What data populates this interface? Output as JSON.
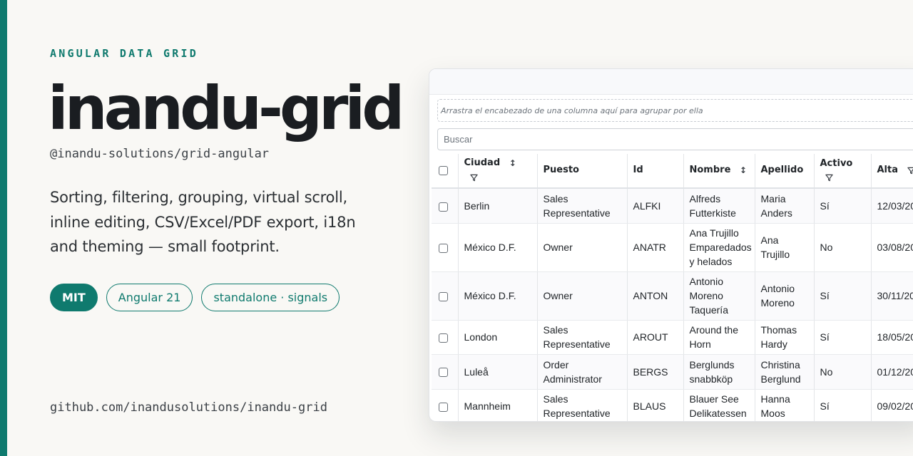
{
  "hero": {
    "eyebrow": "ANGULAR DATA GRID",
    "title": "inandu-grid",
    "package": "@inandu-solutions/grid-angular",
    "description": "Sorting, filtering, grouping, virtual scroll, inline editing, CSV/Excel/PDF export, i18n and theming — small footprint.",
    "badges": [
      "MIT",
      "Angular 21",
      "standalone · signals"
    ],
    "repo": "github.com/inandusolutions/inandu-grid"
  },
  "colors": {
    "accent": "#0f7a6e",
    "background": "#f9f8f5"
  },
  "grid": {
    "group_hint": "Arrastra el encabezado de una columna aquí para agrupar por ella",
    "search_placeholder": "Buscar",
    "columns": {
      "ciudad": "Ciudad",
      "puesto": "Puesto",
      "id": "Id",
      "nombre": "Nombre",
      "apellido": "Apellido",
      "activo": "Activo",
      "alta": "Alta"
    },
    "rows": [
      {
        "ciudad": "Berlin",
        "puesto": "Sales Representative",
        "id": "ALFKI",
        "nombre": "Alfreds Futterkiste",
        "apellido": "Maria Anders",
        "activo": "Sí",
        "alta": "12/03/20"
      },
      {
        "ciudad": "México D.F.",
        "puesto": "Owner",
        "id": "ANATR",
        "nombre": "Ana Trujillo Emparedados y helados",
        "apellido": "Ana Trujillo",
        "activo": "No",
        "alta": "03/08/20"
      },
      {
        "ciudad": "México D.F.",
        "puesto": "Owner",
        "id": "ANTON",
        "nombre": "Antonio Moreno Taquería",
        "apellido": "Antonio Moreno",
        "activo": "Sí",
        "alta": "30/11/20"
      },
      {
        "ciudad": "London",
        "puesto": "Sales Representative",
        "id": "AROUT",
        "nombre": "Around the Horn",
        "apellido": "Thomas Hardy",
        "activo": "Sí",
        "alta": "18/05/20"
      },
      {
        "ciudad": "Luleå",
        "puesto": "Order Administrator",
        "id": "BERGS",
        "nombre": "Berglunds snabbköp",
        "apellido": "Christina Berglund",
        "activo": "No",
        "alta": "01/12/20"
      },
      {
        "ciudad": "Mannheim",
        "puesto": "Sales Representative",
        "id": "BLAUS",
        "nombre": "Blauer See Delikatessen",
        "apellido": "Hanna Moos",
        "activo": "Sí",
        "alta": "09/02/20"
      }
    ]
  }
}
